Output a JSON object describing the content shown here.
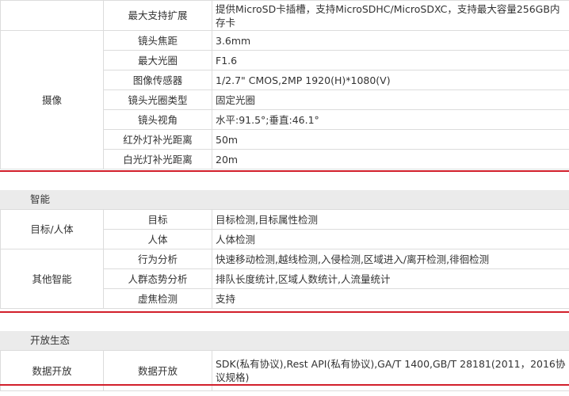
{
  "storage": {
    "rows": [
      {
        "key": "最大支持扩展",
        "value": "提供MicroSD卡插槽，支持MicroSDHC/MicroSDXC，支持最大容量256GB内存卡"
      }
    ]
  },
  "camera": {
    "category": "摄像",
    "rows": [
      {
        "key": "镜头焦距",
        "value": "3.6mm"
      },
      {
        "key": "最大光圈",
        "value": "F1.6"
      },
      {
        "key": "图像传感器",
        "value": "1/2.7\" CMOS,2MP 1920(H)*1080(V)"
      },
      {
        "key": "镜头光圈类型",
        "value": "固定光圈"
      },
      {
        "key": "镜头视角",
        "value": "水平:91.5°;垂直:46.1°"
      },
      {
        "key": "红外灯补光距离",
        "value": "50m"
      },
      {
        "key": "白光灯补光距离",
        "value": "20m"
      }
    ]
  },
  "smart": {
    "title": "智能",
    "groups": [
      {
        "category": "目标/人体",
        "rows": [
          {
            "key": "目标",
            "value": "目标检测,目标属性检测"
          },
          {
            "key": "人体",
            "value": "人体检测"
          }
        ]
      },
      {
        "category": "其他智能",
        "rows": [
          {
            "key": "行为分析",
            "value": "快速移动检测,越线检测,入侵检测,区域进入/离开检测,徘徊检测"
          },
          {
            "key": "人群态势分析",
            "value": "排队长度统计,区域人数统计,人流量统计"
          },
          {
            "key": "虚焦检测",
            "value": "支持"
          }
        ]
      }
    ]
  },
  "ecosystem": {
    "title": "开放生态",
    "rows": [
      {
        "category": "数据开放",
        "key": "数据开放",
        "value": "SDK(私有协议),Rest API(私有协议),GA/T 1400,GB/T 28181(2011，2016协议规格)"
      }
    ]
  }
}
